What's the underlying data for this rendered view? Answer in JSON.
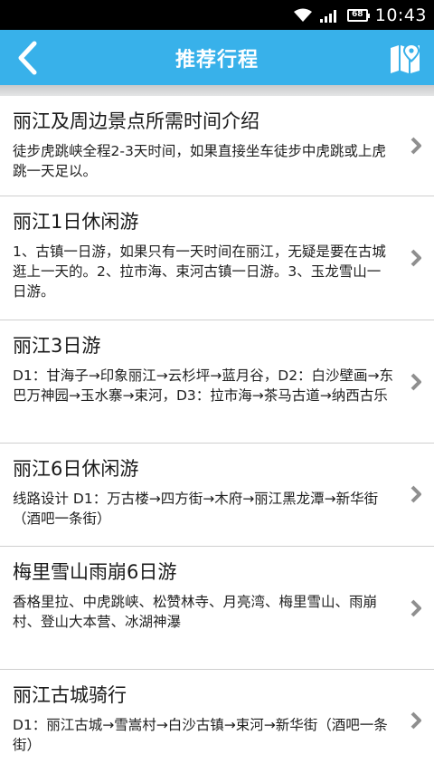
{
  "status_bar": {
    "battery": "68",
    "time": "10:43"
  },
  "header": {
    "title": "推荐行程"
  },
  "items": [
    {
      "title": "丽江及周边景点所需时间介绍",
      "desc": "徒步虎跳峡全程2-3天时间，如果直接坐车徒步中虎跳或上虎跳一天足以。"
    },
    {
      "title": "丽江1日休闲游",
      "desc": "1、古镇一日游，如果只有一天时间在丽江，无疑是要在古城逛上一天的。2、拉市海、束河古镇一日游。3、玉龙雪山一日游。"
    },
    {
      "title": "丽江3日游",
      "desc": " D1：甘海子→印象丽江→云杉坪→蓝月谷，D2：白沙壁画→东巴万神园→玉水寨→束河，D3：拉市海→茶马古道→纳西古乐"
    },
    {
      "title": "丽江6日休闲游",
      "desc": "线路设计 D1：万古楼→四方街→木府→丽江黑龙潭→新华街（酒吧一条街）"
    },
    {
      "title": "梅里雪山雨崩6日游",
      "desc": "香格里拉、中虎跳峡、松赞林寺、月亮湾、梅里雪山、雨崩村、登山大本营、冰湖神瀑"
    },
    {
      "title": "丽江古城骑行",
      "desc": "D1：丽江古城→雪嵩村→白沙古镇→束河→新华街（酒吧一条街）"
    }
  ]
}
